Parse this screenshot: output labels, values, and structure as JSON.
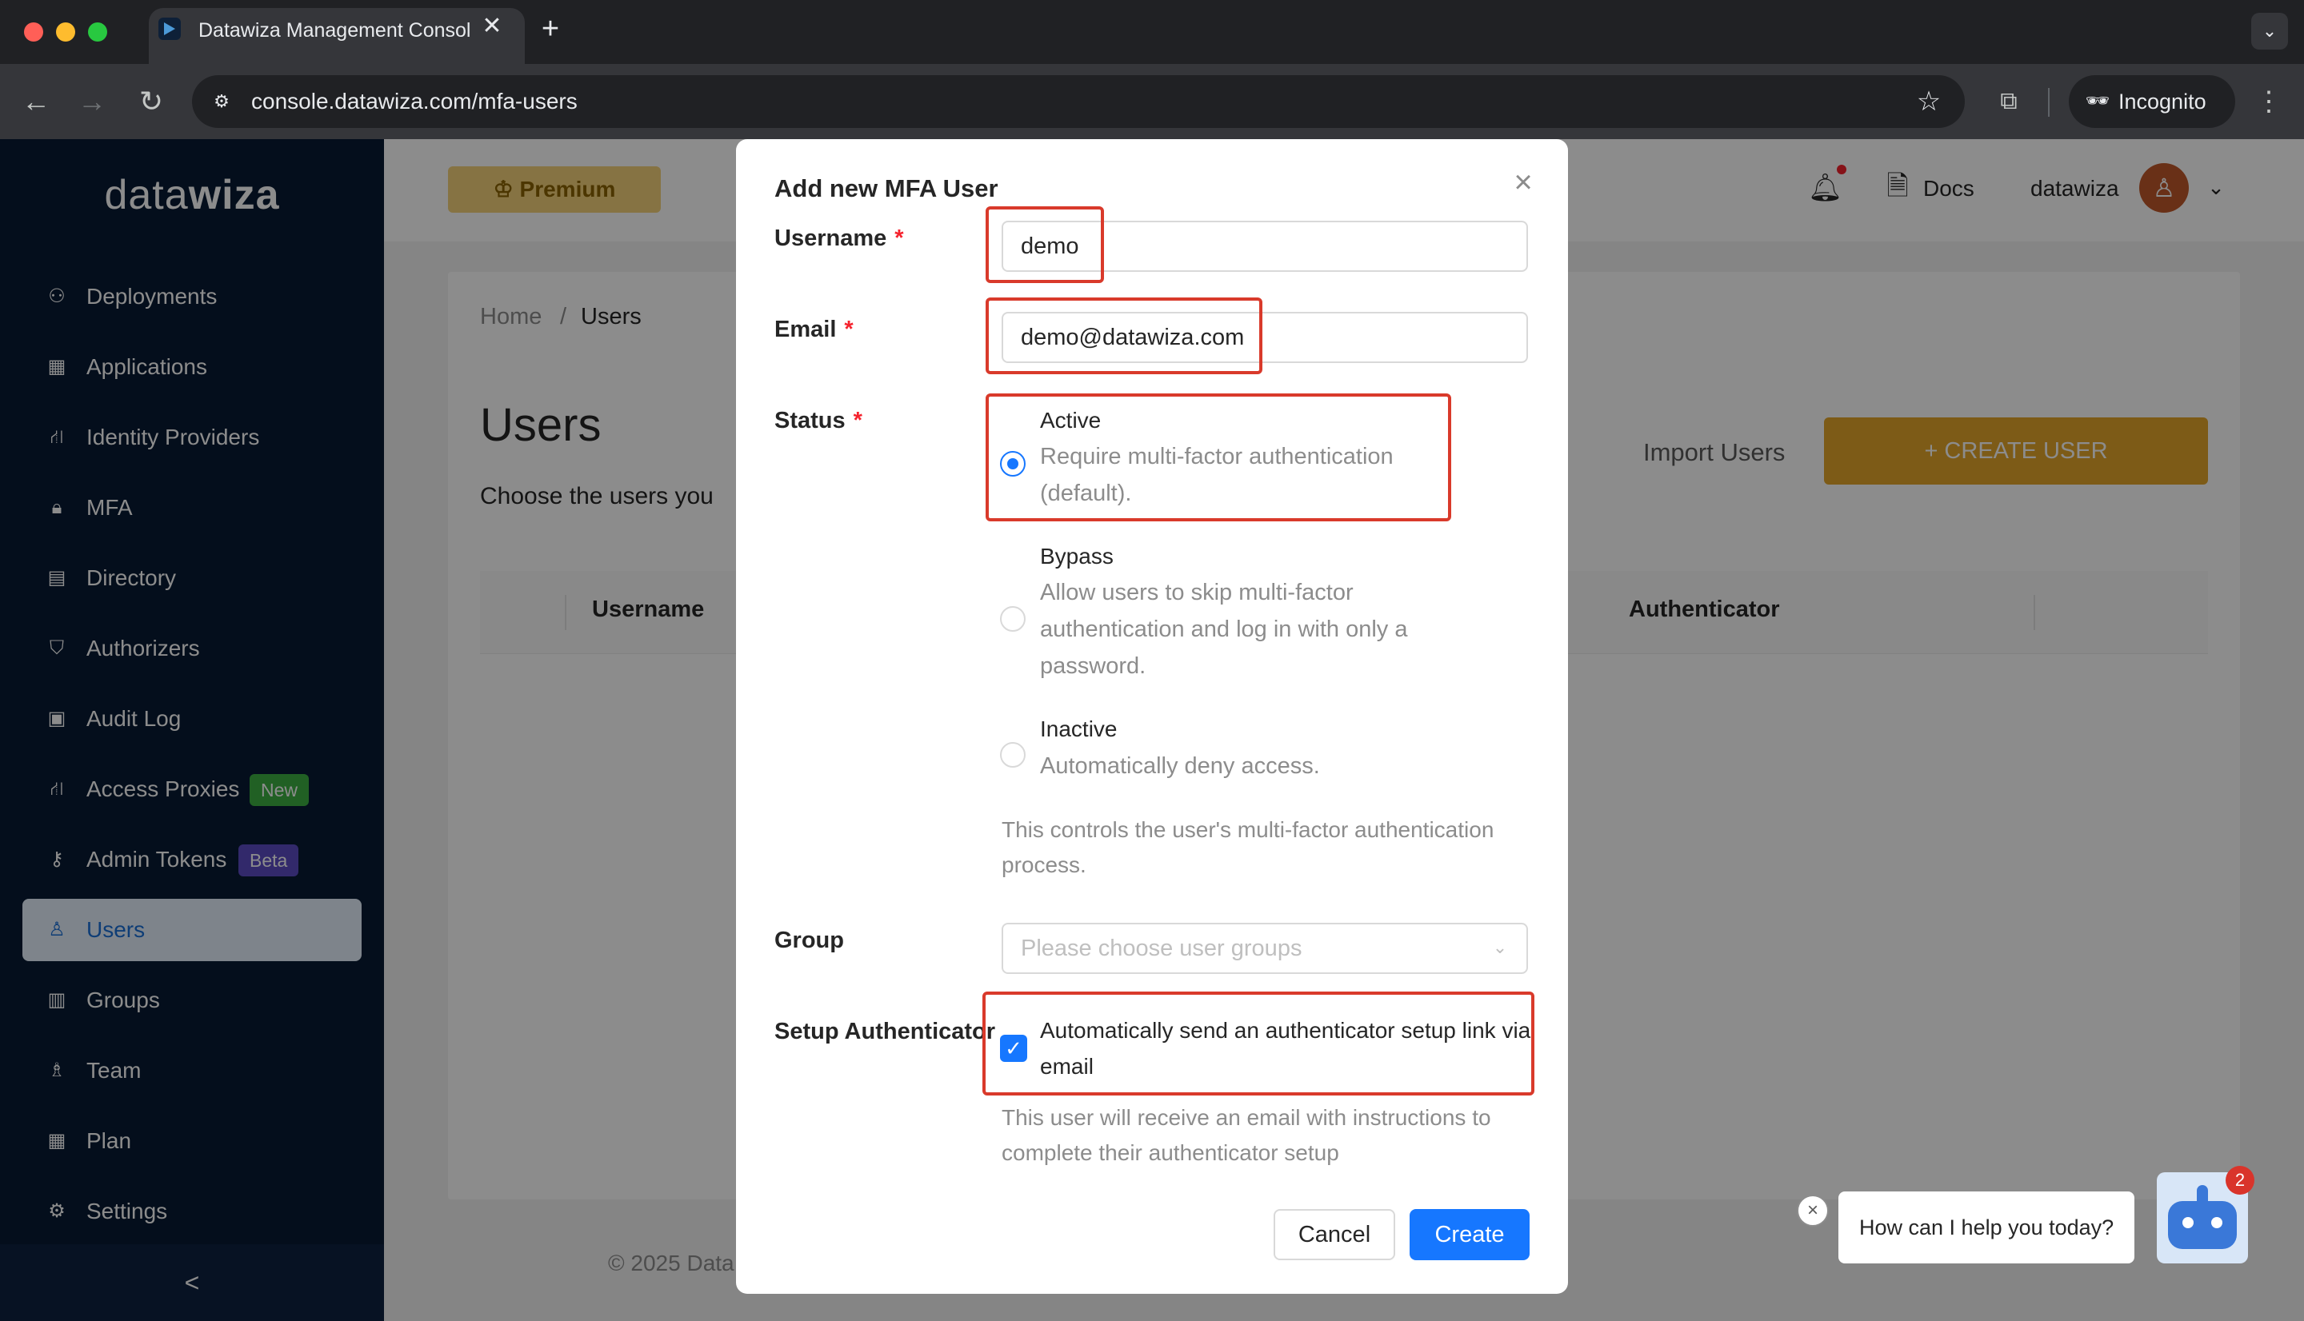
{
  "browser": {
    "tab_title": "Datawiza Management Console",
    "tab_close": "✕",
    "new_tab": "+",
    "url": "console.datawiza.com/mfa-users",
    "incognito_label": "Incognito"
  },
  "sidebar": {
    "logo_left": "data",
    "logo_right": "wiza",
    "items": [
      {
        "label": "Deployments",
        "icon": "deployments-icon",
        "glyph": "⚇"
      },
      {
        "label": "Applications",
        "icon": "applications-icon",
        "glyph": "▦"
      },
      {
        "label": "Identity Providers",
        "icon": "identity-providers-icon",
        "glyph": "⛙"
      },
      {
        "label": "MFA",
        "icon": "lock-icon",
        "glyph": "🔒︎"
      },
      {
        "label": "Directory",
        "icon": "directory-icon",
        "glyph": "▤"
      },
      {
        "label": "Authorizers",
        "icon": "shield-icon",
        "glyph": "⛉"
      },
      {
        "label": "Audit Log",
        "icon": "audit-log-icon",
        "glyph": "▣"
      },
      {
        "label": "Access Proxies",
        "icon": "access-proxies-icon",
        "glyph": "⛙",
        "badge": "New"
      },
      {
        "label": "Admin Tokens",
        "icon": "key-icon",
        "glyph": "⚷",
        "badge": "Beta"
      },
      {
        "label": "Users",
        "icon": "user-icon",
        "glyph": "♙"
      },
      {
        "label": "Groups",
        "icon": "groups-icon",
        "glyph": "▥"
      },
      {
        "label": "Team",
        "icon": "team-icon",
        "glyph": "♗"
      },
      {
        "label": "Plan",
        "icon": "plan-icon",
        "glyph": "▦"
      },
      {
        "label": "Settings",
        "icon": "gear-icon",
        "glyph": "⚙"
      }
    ],
    "active_item": "Users",
    "collapse_glyph": "<"
  },
  "header": {
    "premium_label": "Premium",
    "docs_label": "Docs",
    "username": "datawiza"
  },
  "page": {
    "breadcrumb_home": "Home",
    "breadcrumb_sep": "/",
    "breadcrumb_current": "Users",
    "title": "Users",
    "description": "Choose the users you",
    "import_label": "Import Users",
    "create_label": "+ CREATE USER",
    "columns": [
      "Username",
      "Authenticator"
    ],
    "footer": "© 2025 Data"
  },
  "modal": {
    "title": "Add new MFA User",
    "username_label": "Username",
    "username_value": "demo",
    "email_label": "Email",
    "email_value": "demo@datawiza.com",
    "status_label": "Status",
    "required_mark": "*",
    "status_options": [
      {
        "title": "Active",
        "desc": "Require multi-factor authentication (default).",
        "selected": true
      },
      {
        "title": "Bypass",
        "desc": "Allow users to skip multi-factor authentication and log in with only a password.",
        "selected": false
      },
      {
        "title": "Inactive",
        "desc": "Automatically deny access.",
        "selected": false
      }
    ],
    "status_help": "This controls the user's multi-factor authentication process.",
    "group_label": "Group",
    "group_placeholder": "Please choose user groups",
    "setup_label": "Setup Authenticator",
    "setup_checkbox_label": "Automatically send an authenticator setup link via email",
    "setup_checked": true,
    "setup_help": "This user will receive an email with instructions to complete their authenticator setup",
    "cancel_label": "Cancel",
    "create_label": "Create"
  },
  "chat": {
    "prompt": "How can I help you today?",
    "badge_count": "2"
  },
  "colors": {
    "sidebar_bg": "#081a33",
    "primary": "#1677ff",
    "accent_gold": "#e3a62a",
    "highlight_red": "#d93a2b",
    "badge_new": "#3cb043",
    "badge_beta": "#5b4bc4"
  }
}
